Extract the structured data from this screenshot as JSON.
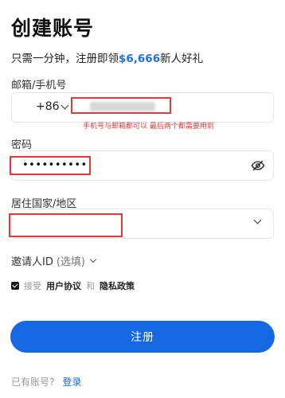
{
  "header": {
    "title": "创建账号",
    "subtitle_prefix": "只需一分钟，注册即领",
    "subtitle_amount": "$6,666",
    "subtitle_suffix": "新人好礼"
  },
  "phone": {
    "label": "邮箱/手机号",
    "country_code": "+86"
  },
  "annotation_note": "手机号与邮箱都可以 最后两个都需要用到",
  "password": {
    "label": "密码",
    "value": "••••••••••"
  },
  "country": {
    "label": "居住国家/地区"
  },
  "invite": {
    "label": "邀请人ID",
    "optional": "(选填)"
  },
  "agreement": {
    "prefix": "接受",
    "user_agreement": "用户协议",
    "and": "和",
    "privacy_policy": "隐私政策"
  },
  "register_button": "注册",
  "login": {
    "prompt": "已有账号?",
    "link": "登录"
  },
  "colors": {
    "accent": "#1667e6",
    "annotation": "#e03a3a"
  }
}
